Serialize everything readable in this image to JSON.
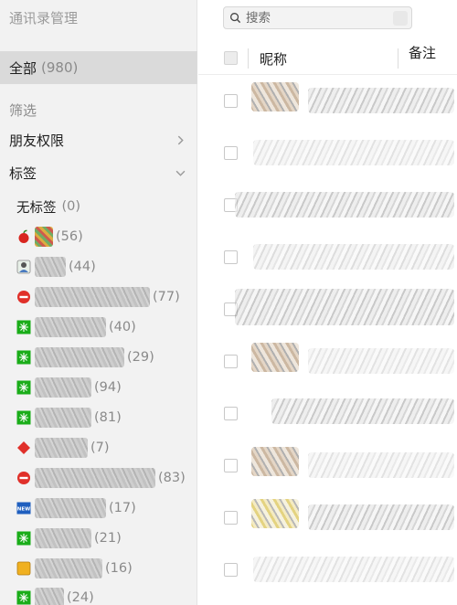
{
  "sidebar": {
    "title": "通讯录管理",
    "all": {
      "label": "全部",
      "count": "(980)"
    },
    "filter_title": "筛选",
    "friend_permission": "朋友权限",
    "tags_label": "标签",
    "tags": [
      {
        "icon": "none",
        "label": "无标签",
        "count": "(0)"
      },
      {
        "icon": "apple-icon",
        "count": "(56)"
      },
      {
        "icon": "person-icon",
        "count": "(44)"
      },
      {
        "icon": "no-entry-icon",
        "count": "(77)"
      },
      {
        "icon": "sparkle-icon",
        "count": "(40)"
      },
      {
        "icon": "sparkle-icon",
        "count": "(29)"
      },
      {
        "icon": "sparkle-icon",
        "count": "(94)"
      },
      {
        "icon": "sparkle-icon",
        "count": "(81)"
      },
      {
        "icon": "diamond-icon",
        "count": "(7)"
      },
      {
        "icon": "no-entry-icon",
        "count": "(83)"
      },
      {
        "icon": "new-badge-icon",
        "count": "(17)"
      },
      {
        "icon": "sparkle-icon",
        "count": "(21)"
      },
      {
        "icon": "yellow-square-icon",
        "count": "(16)"
      },
      {
        "icon": "sparkle-icon",
        "count": "(24)"
      }
    ]
  },
  "main": {
    "search_placeholder": "搜索",
    "columns": {
      "nickname": "昵称",
      "remark": "备注"
    }
  },
  "colors": {
    "sidebar_bg": "#f2f2f2",
    "selected_bg": "#dadada",
    "green_tag": "#1aad19",
    "red_tag": "#e0302a",
    "blue_tag": "#1f5fbf"
  }
}
